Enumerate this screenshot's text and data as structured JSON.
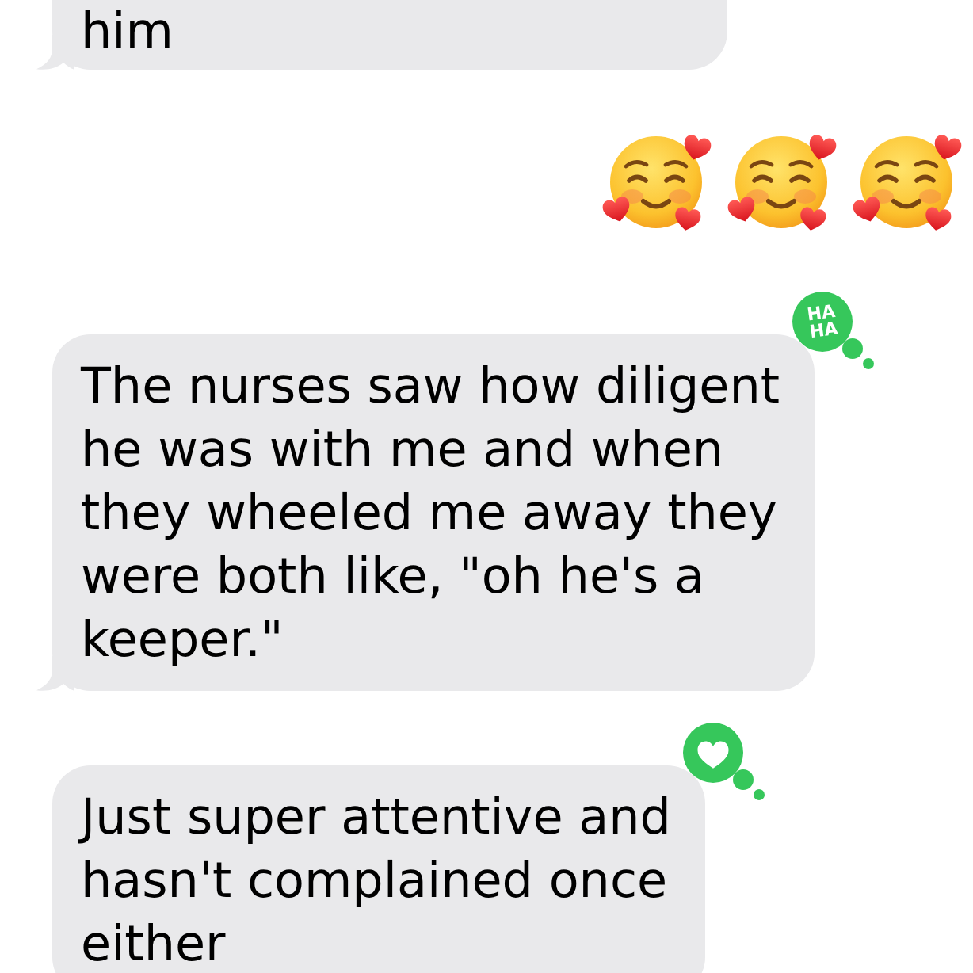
{
  "messages": [
    {
      "kind": "text",
      "outgoing": false,
      "lines": [
        "him"
      ],
      "clipped_top": true,
      "tail": true
    },
    {
      "kind": "emoji",
      "outgoing": true,
      "emojis": [
        {
          "kind": "smiling_face_with_hearts"
        },
        {
          "kind": "smiling_face_with_hearts"
        },
        {
          "kind": "smiling_face_with_hearts"
        }
      ]
    },
    {
      "kind": "text",
      "outgoing": false,
      "lines": [
        "The nurses saw how diligent",
        "he was with me and when",
        "they wheeled me away they",
        "were both like, \"oh he's a",
        "keeper.\""
      ],
      "clipped_top": false,
      "tail": true,
      "reaction": {
        "kind": "haha",
        "lines": [
          "HA",
          "HA"
        ]
      }
    },
    {
      "kind": "text",
      "outgoing": false,
      "lines": [
        "Just super attentive and",
        "hasn't complained once",
        "either"
      ],
      "clipped_top": false,
      "tail": false,
      "reaction": {
        "kind": "heart"
      }
    }
  ]
}
